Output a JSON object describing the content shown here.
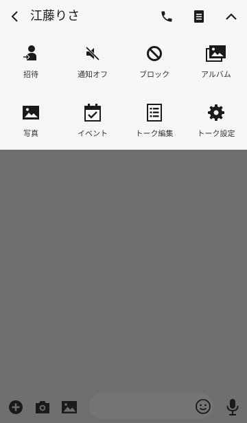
{
  "header": {
    "title": "江藤りさ",
    "back_icon": "chevron-left-icon",
    "call_icon": "phone-icon",
    "notes_icon": "note-icon",
    "collapse_icon": "chevron-up-icon"
  },
  "menu": {
    "items": [
      {
        "label": "招待",
        "icon": "invite-person-icon"
      },
      {
        "label": "通知オフ",
        "icon": "speaker-mute-icon"
      },
      {
        "label": "ブロック",
        "icon": "block-icon"
      },
      {
        "label": "アルバム",
        "icon": "album-icon"
      },
      {
        "label": "写真",
        "icon": "photo-icon"
      },
      {
        "label": "イベント",
        "icon": "calendar-check-icon"
      },
      {
        "label": "トーク編集",
        "icon": "list-edit-icon"
      },
      {
        "label": "トーク設定",
        "icon": "gear-icon"
      }
    ]
  },
  "composer": {
    "icons": [
      "plus-icon",
      "camera-icon",
      "image-icon",
      "emoji-icon",
      "microphone-icon"
    ],
    "input_value": ""
  },
  "colors": {
    "header_bg": "#f6f6f6",
    "chat_bg": "#6f6f6f",
    "icon": "#1a1a1a"
  }
}
